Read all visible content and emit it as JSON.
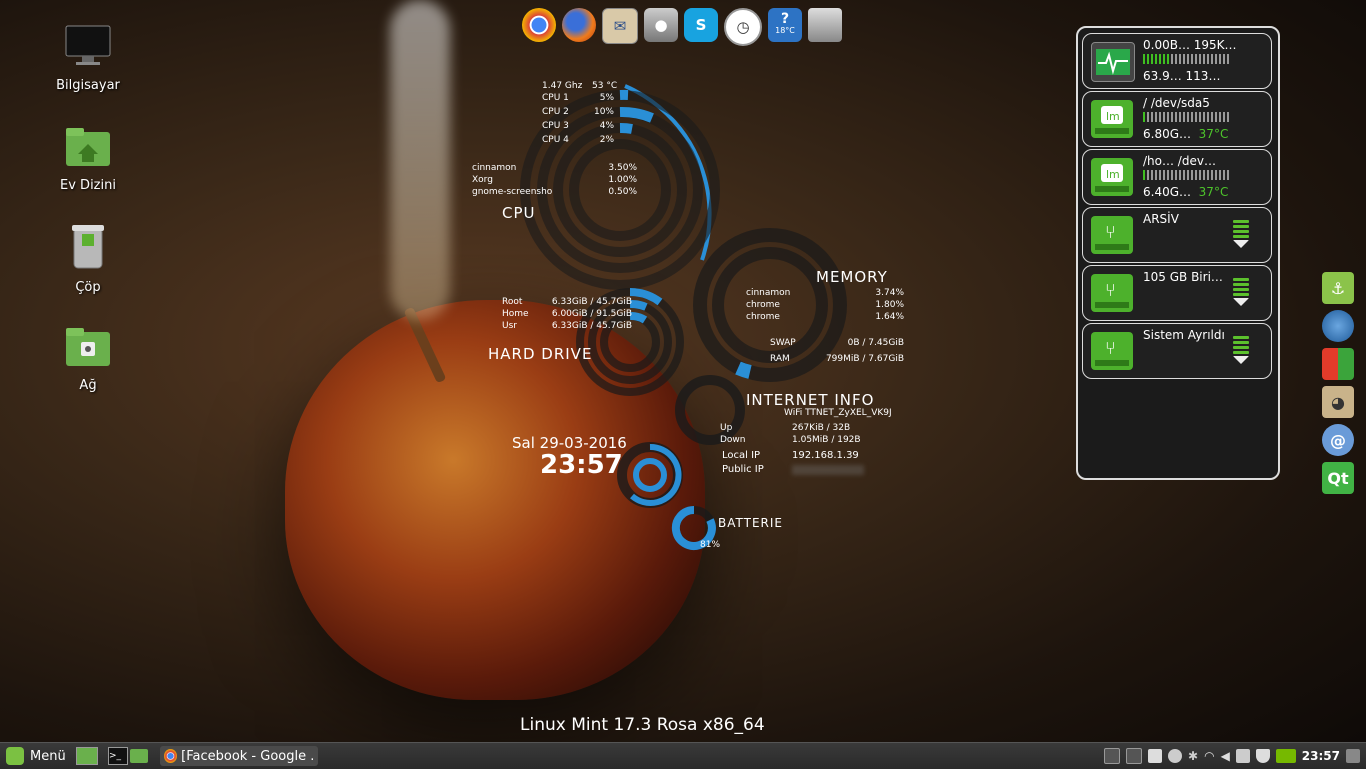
{
  "desktop_icons": [
    {
      "label": "Bilgisayar",
      "icon": "monitor-icon"
    },
    {
      "label": "Ev Dizini",
      "icon": "home-folder-icon"
    },
    {
      "label": "Çöp",
      "icon": "trash-icon"
    },
    {
      "label": "Ağ",
      "icon": "network-folder-icon"
    }
  ],
  "dock": {
    "weather_text": "18°C"
  },
  "conky": {
    "cpu": {
      "freq": "1.47 Ghz",
      "temp": "53 °C",
      "title": "CPU",
      "cores": [
        {
          "name": "CPU 1",
          "value": "5%"
        },
        {
          "name": "CPU 2",
          "value": "10%"
        },
        {
          "name": "CPU 3",
          "value": "4%"
        },
        {
          "name": "CPU 4",
          "value": "2%"
        }
      ],
      "procs": [
        {
          "name": "cinnamon",
          "value": "3.50%"
        },
        {
          "name": "Xorg",
          "value": "1.00%"
        },
        {
          "name": "gnome-screensho",
          "value": "0.50%"
        }
      ]
    },
    "memory": {
      "title": "MEMORY",
      "procs": [
        {
          "name": "cinnamon",
          "value": "3.74%"
        },
        {
          "name": "chrome",
          "value": "1.80%"
        },
        {
          "name": "chrome",
          "value": "1.64%"
        }
      ],
      "swap_label": "SWAP",
      "swap_value": "0B  / 7.45GiB",
      "ram_label": "RAM",
      "ram_value": "799MiB / 7.67GiB"
    },
    "disk": {
      "title": "HARD DRIVE",
      "rows": [
        {
          "name": "Root",
          "value": "6.33GiB / 45.7GiB"
        },
        {
          "name": "Home",
          "value": "6.00GiB / 91.5GiB"
        },
        {
          "name": "Usr",
          "value": "6.33GiB / 45.7GiB"
        }
      ]
    },
    "net": {
      "title": "INTERNET INFO",
      "ssid": "WiFi  TTNET_ZyXEL_VK9J",
      "up_label": "Up",
      "up_value": "267KiB / 32B",
      "down_label": "Down",
      "down_value": "1.05MiB / 192B",
      "local_label": "Local IP",
      "local_value": "192.168.1.39",
      "public_label": "Public IP"
    },
    "clock": {
      "date": "Sal 29-03-2016",
      "time": "23:57"
    },
    "battery": {
      "title": "BATTERIE",
      "value": "81%"
    },
    "os": "Linux Mint 17.3 Rosa x86_64"
  },
  "panel": {
    "cards": [
      {
        "line1": "0.00B…   195K…",
        "line2": "63.9…    113…",
        "type": "network",
        "bar": 0.3
      },
      {
        "line1": "/     /dev/sda5",
        "line2": "6.80G…",
        "temp": "37°C",
        "type": "drive",
        "bar": 0.05
      },
      {
        "line1": "/ho…    /dev…",
        "line2": "6.40G…",
        "temp": "37°C",
        "type": "drive",
        "bar": 0.05
      },
      {
        "line1": "ARSİV",
        "type": "usb"
      },
      {
        "line1": "105 GB Biri…",
        "type": "usb"
      },
      {
        "line1": "Sistem Ayrıldı",
        "type": "usb"
      }
    ]
  },
  "taskbar": {
    "menu_label": "Menü",
    "window_label": "[Facebook - Google ...",
    "clock": "23:57"
  }
}
